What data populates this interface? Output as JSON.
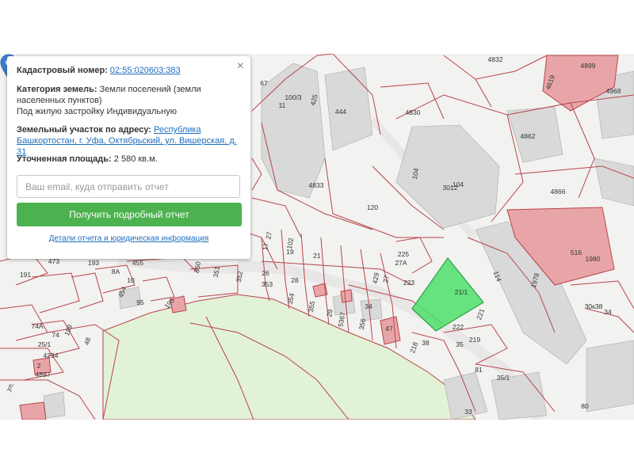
{
  "popup": {
    "close_icon": "×",
    "cadastral_label": "Кадастровый номер:",
    "cadastral_number": "02:55:020603:383",
    "category_label": "Категория земель:",
    "category_value": "Земли поселений (земли населенных пунктов)",
    "usage": "Под жилую застройку Индивидуальную",
    "address_label": "Земельный участок по адресу:",
    "address_value": "Республика Башкортостан, г. Уфа, Октябрьский, ул. Вишерская, д. 31",
    "area_label": "Уточненная площадь:",
    "area_value": "2 580 кв.м.",
    "email_placeholder": "Ваш email, куда отправить отчет",
    "report_button": "Получить подробный отчет",
    "details_link": "Детали отчета и юридическая информация"
  },
  "map": {
    "selected_plot_color": "#4ee06a",
    "highlight_color": "#e8a5a8",
    "park_color": "#e2f2d6",
    "building_color": "#d9d9d9",
    "border_color": "#b8444a",
    "labels": [
      "4832",
      "4899",
      "4619",
      "4968",
      "67",
      "100/3",
      "425",
      "444",
      "4830",
      "11",
      "4862",
      "104",
      "104",
      "4833",
      "3012",
      "4866",
      "120",
      "516",
      "1980",
      "225",
      "27А",
      "223",
      "114",
      "1978",
      "30к38",
      "34",
      "222",
      "221",
      "219",
      "35",
      "81",
      "35/1",
      "80",
      "33",
      "218",
      "38",
      "17",
      "102",
      "27",
      "19",
      "21",
      "26",
      "28",
      "429",
      "27",
      "350",
      "351",
      "352",
      "353",
      "354",
      "355",
      "29",
      "5367",
      "356",
      "34",
      "47",
      "193",
      "455",
      "10",
      "8А",
      "454",
      "95",
      "195",
      "191",
      "473",
      "74А",
      "74",
      "199",
      "48",
      "4234",
      "4897",
      "2",
      "25/1",
      "21/1",
      "ул."
    ]
  }
}
